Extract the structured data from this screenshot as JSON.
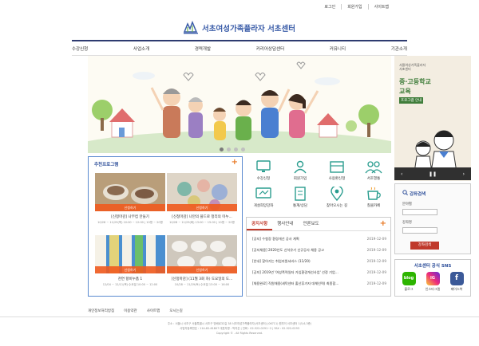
{
  "top_links": [
    "로그인",
    "회원가입",
    "사이트맵"
  ],
  "logo": {
    "text": "서초여성가족플라자 서초센터",
    "sub": "SEOCHO"
  },
  "nav": [
    "수강신청",
    "사업소개",
    "경력개발",
    "커리어상담센터",
    "커뮤니티",
    "기관소개"
  ],
  "side_banner": {
    "small_lines": [
      "서울여성가족플라자",
      "서초센터"
    ],
    "title1": "중·고등학교",
    "title2": "교육",
    "title3": "프로그램 안내",
    "prev": "‹",
    "pause": "❚❚",
    "next": "›"
  },
  "recommended": {
    "title": "추천프로그램",
    "more": "+",
    "cards": [
      {
        "tag": "신청하기",
        "title": "[신청마감] 나무컵 만들기",
        "sub": "10/28 ~ 11/29(목) 10:00 ~ 12:00 | 10명 ~ 20명"
      },
      {
        "tag": "신청하기",
        "title": "[신청마감] 나만의 플드로 정리의 미누...",
        "sub": "10/28 ~ 11/29(화) 13:00 ~ 15:00 | 10명 ~ 20명"
      },
      {
        "tag": "신청하기",
        "title": "천연 향비누품 1",
        "sub": "12/04 ~ 12/11(목)·수요일 10:00 ~ 12:00"
      },
      {
        "tag": "신청하기",
        "title": "[신청마감] (11월 3회 차) 도요일의 도...",
        "sub": "10/28 ~ 11/29(토)·수요일 13:00 ~ 16:00"
      }
    ]
  },
  "quick_icons": [
    "수강신청",
    "회원가입",
    "사용환신청",
    "서초열통",
    "개설희망강좌",
    "통계/상담",
    "찾아오시는 길",
    "칠클카페"
  ],
  "notice": {
    "tabs": [
      "공지사항",
      "행사안내",
      "언론보도"
    ],
    "more": "+",
    "rows": [
      {
        "title": "[공지] 수험장 환경개선 공사 계획",
        "date": "2019-12-09"
      },
      {
        "title": "[공지채용] 2020년도 신석유기 신규공사 채용 공고",
        "date": "2019-12-09"
      },
      {
        "title": "[안내] 찾아가는 취업지원서비스 (11/20)",
        "date": "2019-12-09"
      },
      {
        "title": "[공지] 2019년 '여성폭력일자 가입환경개선사업' 선정 기업...",
        "date": "2019-12-09"
      },
      {
        "title": "[채용완료] 직원채용(세탁센터 출산휴가자 대체인력) 최종합...",
        "date": "2019-12-09"
      }
    ]
  },
  "search": {
    "title": "강좌검색",
    "label1": "분야별",
    "label2": "강좌명",
    "button": "강좌검색"
  },
  "sns": {
    "title": "서초센터 공식 SNS",
    "items": [
      {
        "icon": "blog",
        "label": "블로그"
      },
      {
        "icon": "IG",
        "label": "인스타그램"
      },
      {
        "icon": "f",
        "label": "페이스북"
      }
    ]
  },
  "footer": {
    "links": [
      "개인정보처리방침",
      "이용약관",
      "사이트맵",
      "오시는길"
    ],
    "info": [
      "주소 : 서울시 서초구 서울특별시 서초구 방배로32길 38 서초여성가족플라자(서초센터) (06711) 원부이 서초센터 1(5,6,3층)",
      "사업자등록번호 : 114-82-61807 대표자명 : 박지은  |  전화 : 02-522-0291~2  |  FAX : 02-522-0293",
      "Copyright © . All Rights Reserved."
    ]
  },
  "colors": {
    "brand": "#3a5ca8",
    "accent": "#e87722",
    "nav_line": "#2e3b70",
    "red": "#c0392b"
  }
}
